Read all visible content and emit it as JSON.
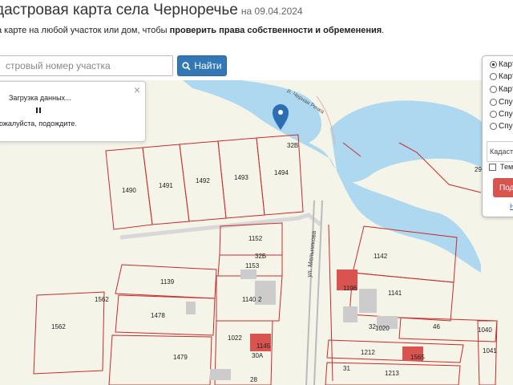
{
  "header": {
    "title": "дастровая карта села Черноречье",
    "date": "на 09.04.2024",
    "subtitle_prefix": "а карте на любой участок или дом, чтобы ",
    "subtitle_bold": "проверить права собственности и обременения",
    "subtitle_suffix": "."
  },
  "search": {
    "placeholder": "стровый номер участка",
    "button_label": "Найти",
    "button_icon": "search-icon"
  },
  "loading": {
    "line1": "Загрузка данных...",
    "line2": "ожалуйста, подождите.",
    "close": "×"
  },
  "layers": {
    "options": [
      {
        "label": "Карт",
        "selected": true
      },
      {
        "label": "Карт",
        "selected": false
      },
      {
        "label": "Карт",
        "selected": false
      },
      {
        "label": "Спу",
        "selected": false
      },
      {
        "label": "Спу",
        "selected": false
      },
      {
        "label": "Спу",
        "selected": false
      }
    ],
    "kadastr_label": "Кадастр",
    "theme_label": "Тем",
    "submit_label": "Подк",
    "link_label": "Н"
  },
  "map": {
    "river_label": "р. Черная Речка",
    "street_label": "ул. Мельникова",
    "marker_icon": "map-pin-icon",
    "colors": {
      "water": "#add8f0",
      "parcel": "#cc2a2a",
      "ground": "#f4f4e9",
      "building": "#cccccc",
      "building_red": "#d9534f"
    },
    "labels": [
      "1490",
      "1491",
      "1492",
      "1493",
      "1494",
      "32В",
      "1152",
      "32Б",
      "1153",
      "1139",
      "1140",
      "2",
      "1562",
      "1562",
      "1478",
      "1022",
      "1145",
      "30А",
      "1479",
      "28",
      "1142",
      "1196",
      "1141",
      "32",
      "1020",
      "46",
      "1212",
      "1565",
      "31",
      "1213",
      "1041",
      "1040",
      "29"
    ]
  }
}
